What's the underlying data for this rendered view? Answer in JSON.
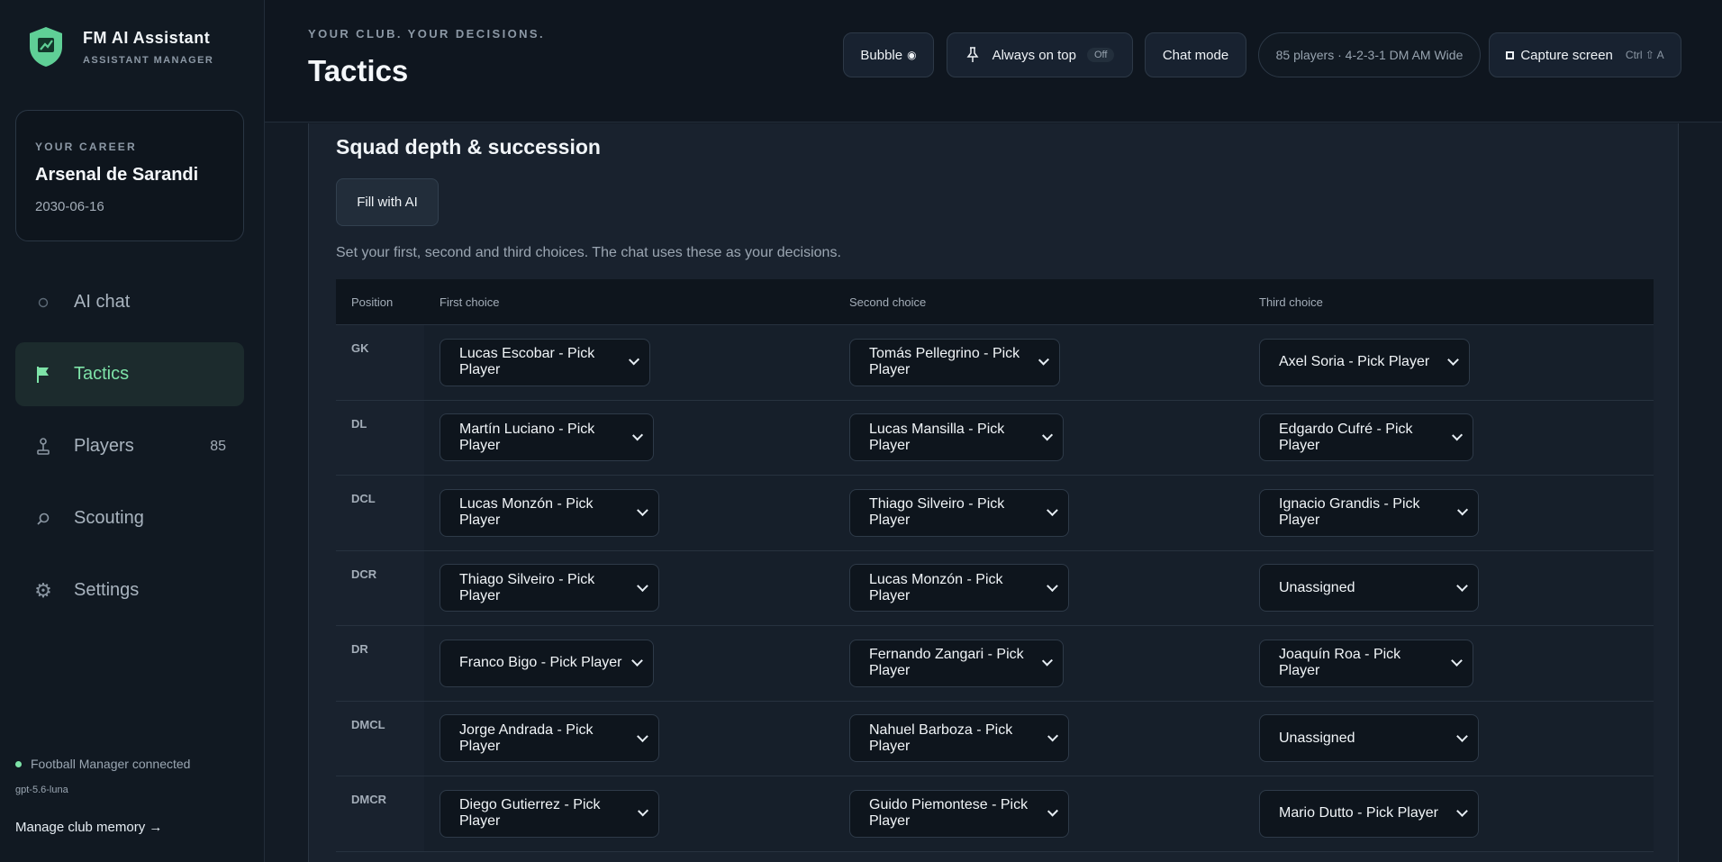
{
  "brand": {
    "title": "FM AI Assistant",
    "subtitle": "ASSISTANT MANAGER"
  },
  "career": {
    "label": "YOUR CAREER",
    "club": "Arsenal de Sarandi",
    "date": "2030-06-16"
  },
  "nav": [
    {
      "label": "AI chat",
      "icon": "circle-icon",
      "active": false
    },
    {
      "label": "Tactics",
      "icon": "flag-icon",
      "active": true
    },
    {
      "label": "Players",
      "icon": "joystick-icon",
      "active": false,
      "count": "85"
    },
    {
      "label": "Scouting",
      "icon": "search-icon",
      "active": false
    },
    {
      "label": "Settings",
      "icon": "gear-icon",
      "active": false
    }
  ],
  "status": {
    "connection": "Football Manager connected",
    "model": "gpt-5.6-luna",
    "manage_link": "Manage club memory →",
    "accent": "#7ee3a8"
  },
  "header": {
    "eyebrow": "YOUR CLUB. YOUR DECISIONS.",
    "title": "Tactics"
  },
  "toolbar": {
    "bubble_label": "Bubble",
    "bubble_icon": "◉",
    "pin_label": "Always on top",
    "pin_state": "Off",
    "chat_mode_label": "Chat mode",
    "squad_summary": "85 players · 4-2-3-1 DM AM Wide",
    "capture_label": "Capture screen",
    "capture_shortcut": "Ctrl ⇧ A"
  },
  "section": {
    "title": "Squad depth & succession",
    "fill_button": "Fill with AI",
    "hint": "Set your first, second and third choices. The chat uses these as your decisions."
  },
  "table": {
    "headers": {
      "position": "Position",
      "first": "First choice",
      "second": "Second choice",
      "third": "Third choice"
    },
    "rows": [
      {
        "pos": "GK",
        "first": "Lucas Escobar - Pick Player",
        "second": "Tomás Pellegrino - Pick Player",
        "third": "Axel Soria - Pick Player"
      },
      {
        "pos": "DL",
        "first": "Martín Luciano - Pick Player",
        "second": "Lucas Mansilla - Pick Player",
        "third": "Edgardo Cufré - Pick Player"
      },
      {
        "pos": "DCL",
        "first": "Lucas Monzón - Pick Player",
        "second": "Thiago Silveiro - Pick Player",
        "third": "Ignacio Grandis - Pick Player"
      },
      {
        "pos": "DCR",
        "first": "Thiago Silveiro - Pick Player",
        "second": "Lucas Monzón - Pick Player",
        "third": "Unassigned"
      },
      {
        "pos": "DR",
        "first": "Franco Bigo - Pick Player",
        "second": "Fernando Zangari - Pick Player",
        "third": "Joaquín Roa - Pick Player"
      },
      {
        "pos": "DMCL",
        "first": "Jorge Andrada - Pick Player",
        "second": "Nahuel Barboza - Pick Player",
        "third": "Unassigned"
      },
      {
        "pos": "DMCR",
        "first": "Diego Gutierrez - Pick Player",
        "second": "Guido Piemontese - Pick Player",
        "third": "Mario Dutto - Pick Player"
      }
    ]
  }
}
